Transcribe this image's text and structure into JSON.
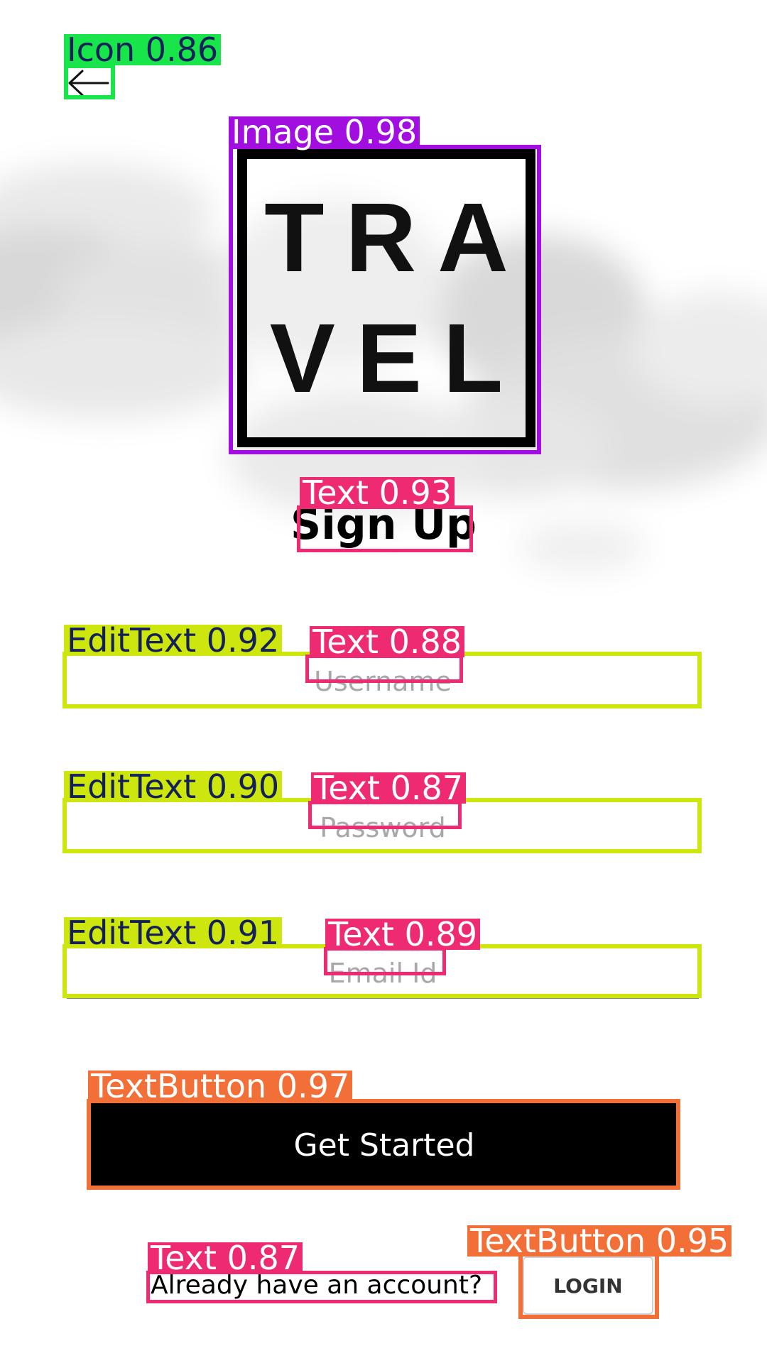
{
  "logo": {
    "line1": "TRA",
    "line2": "VEL"
  },
  "title": "Sign Up",
  "fields": {
    "username_placeholder": "Username",
    "password_placeholder": "Password",
    "email_placeholder": "Email Id"
  },
  "cta_label": "Get Started",
  "footer": {
    "prompt": "Already have an account?",
    "login_label": "LOGIN"
  },
  "icons": {
    "back": "back-arrow-icon"
  },
  "detections": {
    "icon": "Icon 0.86",
    "image": "Image 0.98",
    "title_text": "Text 0.93",
    "edit_username": "EditText 0.92",
    "text_username": "Text 0.88",
    "edit_password": "EditText 0.90",
    "text_password": "Text 0.87",
    "edit_email": "EditText 0.91",
    "text_email": "Text 0.89",
    "button_cta": "TextButton 0.97",
    "text_footer": "Text 0.87",
    "button_login": "TextButton 0.95"
  },
  "colors": {
    "icon_box": "#18e54a",
    "image_box": "#a20ee0",
    "text_box": "#ee2a72",
    "edittext_box": "#cde60e",
    "button_box": "#f26f37",
    "cta_bg": "#000000"
  }
}
